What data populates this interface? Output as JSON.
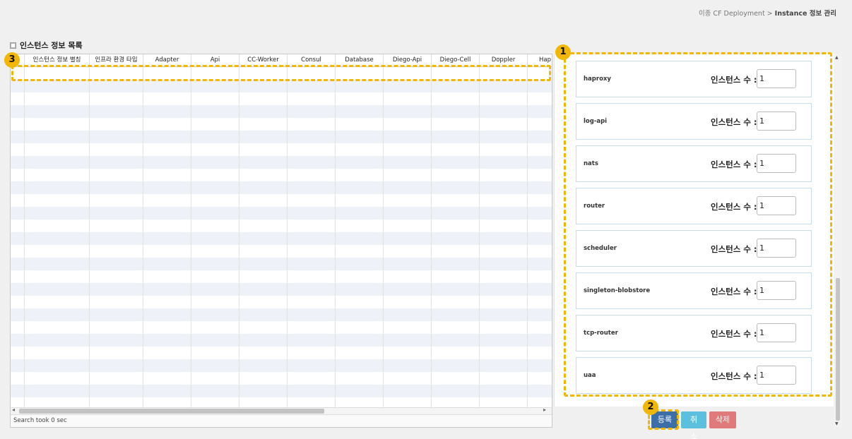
{
  "breadcrumb": {
    "prefix": "이종 CF Deployment > ",
    "current": "Instance 정보 관리"
  },
  "section_title": "인스턴스 정보 목록",
  "grid": {
    "columns": [
      "인스턴스 정보 별칭",
      "인프라 환경 타입",
      "Adapter",
      "Api",
      "CC-Worker",
      "Consul",
      "Database",
      "Diego-Api",
      "Diego-Cell",
      "Doppler",
      "Hap"
    ],
    "footer": "Search took 0 sec"
  },
  "panel": {
    "count_label": "인스턴스 수 :",
    "items": [
      {
        "name": "haproxy",
        "value": "1"
      },
      {
        "name": "log-api",
        "value": "1"
      },
      {
        "name": "nats",
        "value": "1"
      },
      {
        "name": "router",
        "value": "1"
      },
      {
        "name": "scheduler",
        "value": "1"
      },
      {
        "name": "singleton-blobstore",
        "value": "1"
      },
      {
        "name": "tcp-router",
        "value": "1"
      },
      {
        "name": "uaa",
        "value": "1"
      }
    ]
  },
  "buttons": {
    "register": "등록",
    "cancel": "취소",
    "delete": "삭제"
  },
  "annotations": {
    "one": "1",
    "two": "2",
    "three": "3"
  },
  "colors": {
    "annotation": "#f2b705",
    "register": "#3c6fa8",
    "cancel": "#5bc0de",
    "delete": "#e0797a"
  }
}
